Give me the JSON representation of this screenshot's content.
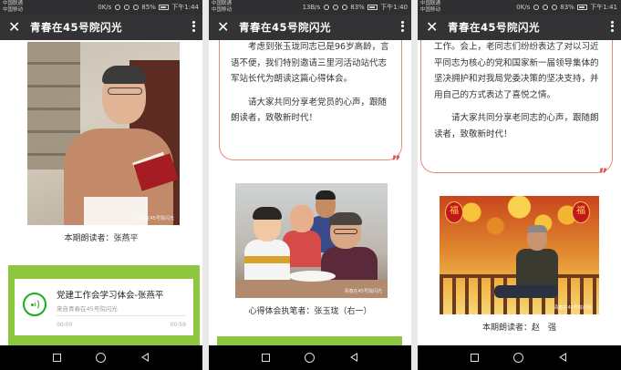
{
  "app": {
    "title": "青春在45号院闪光"
  },
  "screens": [
    {
      "status": {
        "carrier1": "中国联通",
        "carrier2": "中国移动",
        "speed": "0K/s",
        "battery": "85%",
        "time": "下午1:44"
      },
      "photo_watermark": "青春在45号院闪光",
      "caption": "本期朗读者：张燕平",
      "audio": {
        "title": "党建工作会学习体会-张燕平",
        "source": "来自青春在45号院闪光",
        "current_time": "00:00",
        "duration": "00:59"
      }
    },
    {
      "status": {
        "carrier1": "中国联通",
        "carrier2": "中国移动",
        "speed": "13B/s",
        "battery": "83%",
        "time": "下午1:40"
      },
      "quote": {
        "paragraph1": "考虑到张玉珑同志已是96岁高龄，言语不便，我们特别邀请三里河活动站代志军站长代为朗读这篇心得体会。",
        "paragraph2": "请大家共同分享老党员的心声，跟随朗读者，致敬新时代！",
        "mark": "”"
      },
      "photo_watermark": "青春在45号院闪光",
      "caption": "心得体会执笔者：张玉珑（右一）"
    },
    {
      "status": {
        "carrier1": "中国联通",
        "carrier2": "中国移动",
        "speed": "0K/s",
        "battery": "83%",
        "time": "下午1:41"
      },
      "quote": {
        "paragraph1": "工作。会上，老同志们纷纷表达了对以习近平同志为核心的党和国家新一届领导集体的坚决拥护和对我局党委决策的坚决支持，并用自己的方式表达了喜悦之情。",
        "paragraph2": "请大家共同分享老同志的心声，跟随朗读者，致敬新时代！",
        "mark": "”"
      },
      "lantern_char": "福",
      "photo_watermark": "青春在45号院闪光",
      "caption": "本期朗读者：赵　强"
    }
  ],
  "icons": {
    "close": "close-icon",
    "more": "more-icon",
    "audio": "audio-wave-icon",
    "nav_recent": "square-icon",
    "nav_home": "circle-icon",
    "nav_back": "triangle-back-icon"
  },
  "colors": {
    "titlebar": "#333335",
    "statusbar": "#2f2f31",
    "accent_green": "#8dc63f",
    "wechat_green": "#1aad19",
    "quote_border": "#e58a7f"
  }
}
